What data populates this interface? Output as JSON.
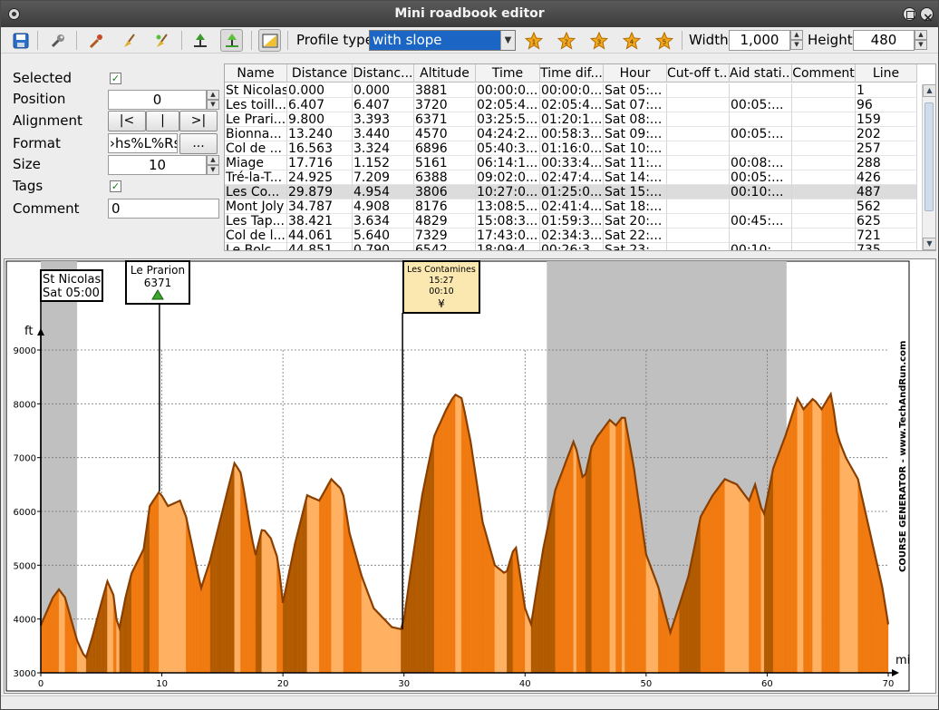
{
  "window": {
    "title": "Mini roadbook editor"
  },
  "toolbar": {
    "profile_type_label": "Profile type",
    "profile_type_value": "with slope",
    "width_label": "Width",
    "width_value": "1,000",
    "height_label": "Height",
    "height_value": "480",
    "icons": [
      "save-icon",
      "wrench-icon",
      "pipette-icon",
      "broom-icon",
      "broom-star-icon",
      "tree-marker-icon",
      "tree-marker-green-icon",
      "image-icon",
      "star-1-icon",
      "star-2-icon",
      "star-3-icon",
      "star-4-icon",
      "star-5-icon"
    ],
    "star_labels": [
      "1",
      "2",
      "3",
      "4",
      "5"
    ],
    "star_color": "#f0a81c"
  },
  "props": {
    "selected_label": "Selected",
    "selected_checked": true,
    "position_label": "Position",
    "position_value": "0",
    "alignment_label": "Alignment",
    "align_left": "|<",
    "align_center": "|",
    "align_right": ">|",
    "format_label": "Format",
    "format_value": "›hs%L%Rs",
    "format_more": "...",
    "size_label": "Size",
    "size_value": "10",
    "tags_label": "Tags",
    "tags_checked": true,
    "comment_label": "Comment",
    "comment_value": "0"
  },
  "table": {
    "columns": [
      "Name",
      "Distance",
      "Distanc...",
      "Altitude",
      "Time",
      "Time dif...",
      "Hour",
      "Cut-off t...",
      "Aid stati...",
      "Comment",
      "Line"
    ],
    "rows": [
      [
        "St Nicolas",
        "0.000",
        "0.000",
        "3881",
        "00:00:0...",
        "00:00:0...",
        "Sat 05:...",
        "",
        "",
        "",
        "1"
      ],
      [
        "Les toill...",
        "6.407",
        "6.407",
        "3720",
        "02:05:4...",
        "02:05:4...",
        "Sat 07:...",
        "",
        "00:05:...",
        "",
        "96"
      ],
      [
        "Le Prari...",
        "9.800",
        "3.393",
        "6371",
        "03:25:5...",
        "01:20:1...",
        "Sat 08:...",
        "",
        "",
        "",
        "159"
      ],
      [
        "Bionna...",
        "13.240",
        "3.440",
        "4570",
        "04:24:2...",
        "00:58:3...",
        "Sat 09:...",
        "",
        "00:05:...",
        "",
        "202"
      ],
      [
        "Col de ...",
        "16.563",
        "3.324",
        "6896",
        "05:40:3...",
        "01:16:0...",
        "Sat 10:...",
        "",
        "",
        "",
        "257"
      ],
      [
        "Miage",
        "17.716",
        "1.152",
        "5161",
        "06:14:1...",
        "00:33:4...",
        "Sat 11:...",
        "",
        "00:08:...",
        "",
        "288"
      ],
      [
        "Tré-la-T...",
        "24.925",
        "7.209",
        "6388",
        "09:02:0...",
        "02:47:4...",
        "Sat 14:...",
        "",
        "00:05:...",
        "",
        "426"
      ],
      [
        "Les Co...",
        "29.879",
        "4.954",
        "3806",
        "10:27:0...",
        "01:25:0...",
        "Sat 15:...",
        "",
        "00:10:...",
        "",
        "487"
      ],
      [
        "Mont Joly",
        "34.787",
        "4.908",
        "8176",
        "13:08:5...",
        "02:41:4...",
        "Sat 18:...",
        "",
        "",
        "",
        "562"
      ],
      [
        "Les Tap...",
        "38.421",
        "3.634",
        "4829",
        "15:08:3...",
        "01:59:3...",
        "Sat 20:...",
        "",
        "00:45:...",
        "",
        "625"
      ],
      [
        "Col de l...",
        "44.061",
        "5.640",
        "7329",
        "17:43:0...",
        "02:34:3...",
        "Sat 22:...",
        "",
        "",
        "",
        "721"
      ],
      [
        "Le Bolc...",
        "44.851",
        "0.790",
        "6542",
        "18:09:4...",
        "00:26:3...",
        "Sat 23:...",
        "",
        "00:10:...",
        "",
        "735"
      ]
    ],
    "selected_row": 7
  },
  "chart_data": {
    "type": "area",
    "xlabel": "mi",
    "ylabel": "ft",
    "xlim": [
      0,
      70
    ],
    "ylim": [
      3000,
      9000
    ],
    "x_ticks": [
      0,
      10,
      20,
      30,
      40,
      50,
      60,
      70
    ],
    "y_ticks": [
      3000,
      4000,
      5000,
      6000,
      7000,
      8000,
      9000
    ],
    "watermark": "COURSE GENERATOR - www.TechAndRun.com",
    "night_bands": [
      [
        0,
        3
      ],
      [
        41.8,
        61.6
      ]
    ],
    "colors": {
      "dark": "#b25a00",
      "orange": "#f07a10",
      "light": "#ffb060",
      "band": "#c0c0c0",
      "edge": "#8a3f00"
    },
    "x": [
      0,
      1,
      1.5,
      2,
      3,
      3.7,
      4.3,
      5,
      5.5,
      6,
      6.4,
      7,
      7.5,
      8.5,
      9,
      9.8,
      10.5,
      11.5,
      12,
      13.24,
      14,
      15,
      16,
      16.56,
      17.2,
      17.72,
      18.3,
      19,
      19.6,
      20,
      21,
      22,
      23,
      24,
      24.93,
      25.5,
      26.5,
      27.5,
      29,
      29.88,
      30.5,
      31.5,
      32.5,
      33.5,
      34.2,
      34.79,
      35.5,
      36.5,
      37.5,
      38.42,
      39.2,
      40,
      40.5,
      41.5,
      42.5,
      43.5,
      44.06,
      44.85,
      45.5,
      46,
      47,
      47.5,
      48.2,
      49,
      50,
      51,
      52,
      52.8,
      53.5,
      54.5,
      55.5,
      56.5,
      57.5,
      58.5,
      59,
      59.7,
      60.5,
      61.5,
      62.5,
      63,
      63.8,
      64.5,
      65.3,
      65.8,
      66.5,
      67.5,
      68.5,
      69.5,
      70
    ],
    "y": [
      3881,
      4400,
      4550,
      4400,
      3600,
      3250,
      3700,
      4300,
      4700,
      4450,
      3720,
      4400,
      4850,
      5300,
      6100,
      6371,
      6100,
      6200,
      5900,
      4570,
      5100,
      6000,
      6896,
      6700,
      5800,
      5161,
      5700,
      5500,
      5100,
      4300,
      5400,
      6300,
      6200,
      6600,
      6388,
      5600,
      4800,
      4200,
      3850,
      3806,
      4800,
      6300,
      7400,
      7900,
      8176,
      8100,
      7300,
      5800,
      5000,
      4829,
      5400,
      4200,
      3900,
      5300,
      6400,
      7000,
      7329,
      6542,
      7200,
      7400,
      7700,
      7600,
      7800,
      6800,
      5200,
      4600,
      3750,
      4300,
      4800,
      5900,
      6300,
      6600,
      6500,
      6200,
      6500,
      5900,
      6800,
      7400,
      8100,
      7900,
      8100,
      7900,
      8200,
      7400,
      7000,
      6600,
      5600,
      4600,
      3900
    ]
  },
  "markers": [
    {
      "name": "St Nicolas",
      "info": "Sat 05:00",
      "x": 0
    },
    {
      "name": "Le Prarion",
      "info": "6371",
      "x": 9.8
    },
    {
      "name": "Les Contamines",
      "info": "15:27",
      "extra": "00:10",
      "x": 29.88
    }
  ]
}
